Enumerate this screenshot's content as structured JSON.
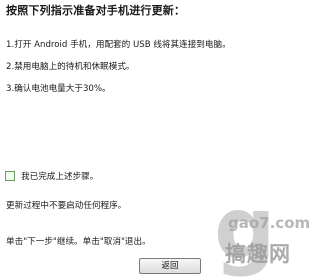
{
  "heading": "按照下列指示准备对手机进行更新：",
  "steps": [
    "1.打开 Android 手机，用配套的 USB 线将其连接到电脑。",
    "2.禁用电脑上的待机和休眠模式。",
    "3.确认电池电量大于30%。"
  ],
  "confirm": {
    "label": "我已完成上述步骤。",
    "checked": false
  },
  "notice": "更新过程中不要启动任何程序。",
  "instruction": "单击\"下一步\"继续。单击\"取消\"退出。",
  "buttons": {
    "back": "返回"
  },
  "watermark": {
    "site": "gao7.com",
    "name": "搞趣网"
  },
  "colors": {
    "checkbox_border": "#6c9a5a",
    "background": "#ffffff"
  }
}
